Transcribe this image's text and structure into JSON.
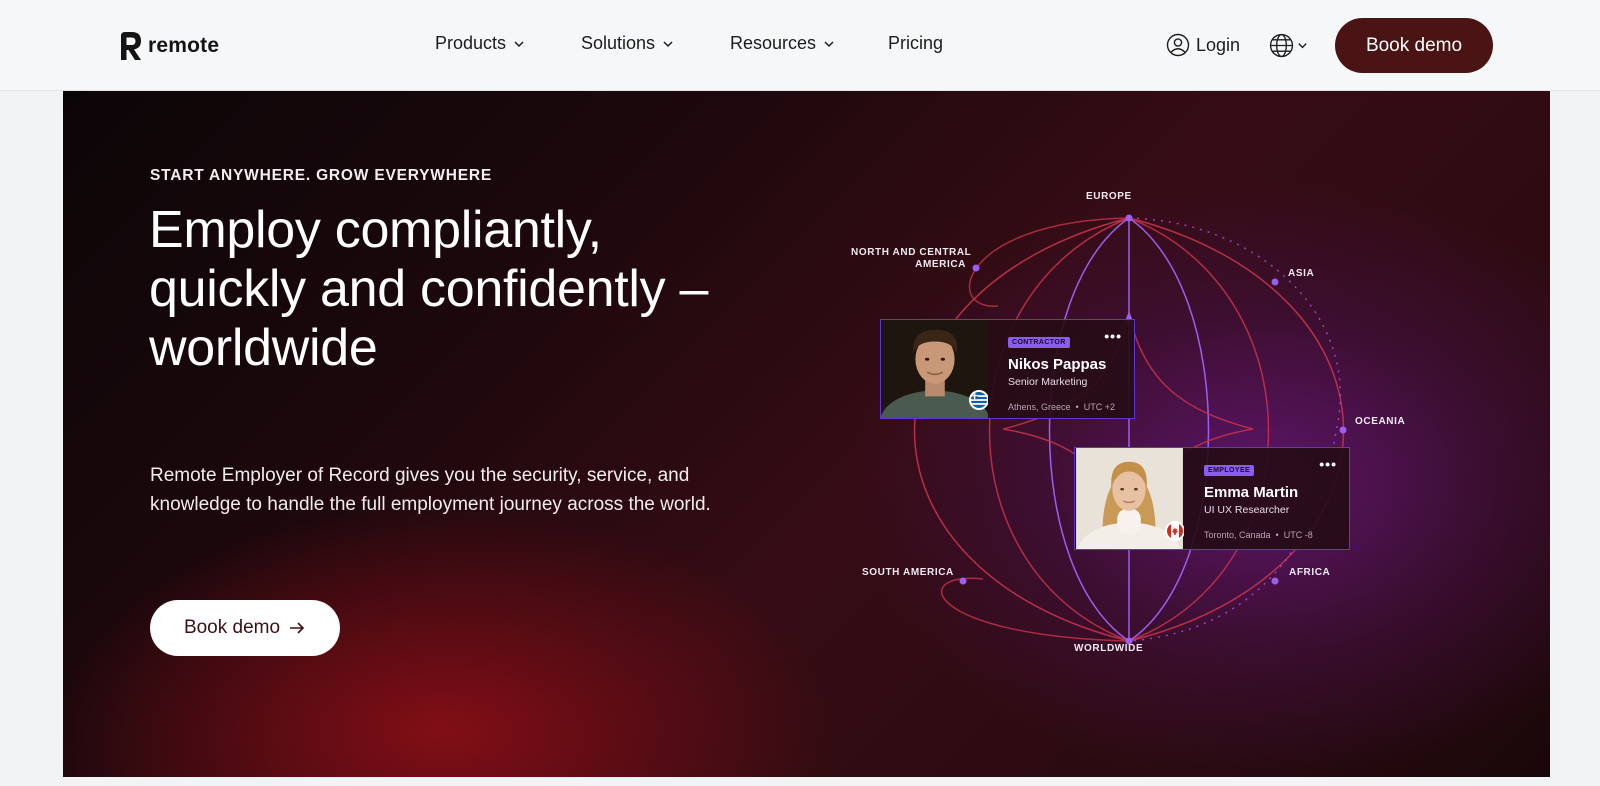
{
  "brand": {
    "name": "remote"
  },
  "nav": {
    "items": [
      {
        "label": "Products",
        "has_menu": true
      },
      {
        "label": "Solutions",
        "has_menu": true
      },
      {
        "label": "Resources",
        "has_menu": true
      },
      {
        "label": "Pricing",
        "has_menu": false
      }
    ],
    "login_label": "Login",
    "language_icon": "globe-icon",
    "cta_label": "Book demo"
  },
  "hero": {
    "eyebrow": "START ANYWHERE. GROW EVERYWHERE",
    "headline": "Employ compliantly, quickly and confidently – worldwide",
    "subtext": "Remote Employer of Record gives you the security, service, and knowledge to handle the full employment journey across the world.",
    "cta_label": "Book demo"
  },
  "regions": {
    "europe": "EUROPE",
    "north_central_america_1": "NORTH AND CENTRAL",
    "north_central_america_2": "AMERICA",
    "asia": "ASIA",
    "oceania": "OCEANIA",
    "south_america": "SOUTH AMERICA",
    "africa": "AFRICA",
    "worldwide": "WORLDWIDE"
  },
  "cards": [
    {
      "badge": "CONTRACTOR",
      "name": "Nikos Pappas",
      "role": "Senior Marketing",
      "city": "Athens, Greece",
      "timezone": "UTC +2",
      "flag_icon": "greece-flag-icon"
    },
    {
      "badge": "EMPLOYEE",
      "name": "Emma Martin",
      "role": "UI UX Researcher",
      "city": "Toronto, Canada",
      "timezone": "UTC -8",
      "flag_icon": "canada-flag-icon"
    }
  ],
  "colors": {
    "cta_dark": "#4a1414",
    "accent_purple": "#8a5cf0",
    "globe_red": "#c8334a",
    "globe_violet": "#9a5ff0"
  }
}
